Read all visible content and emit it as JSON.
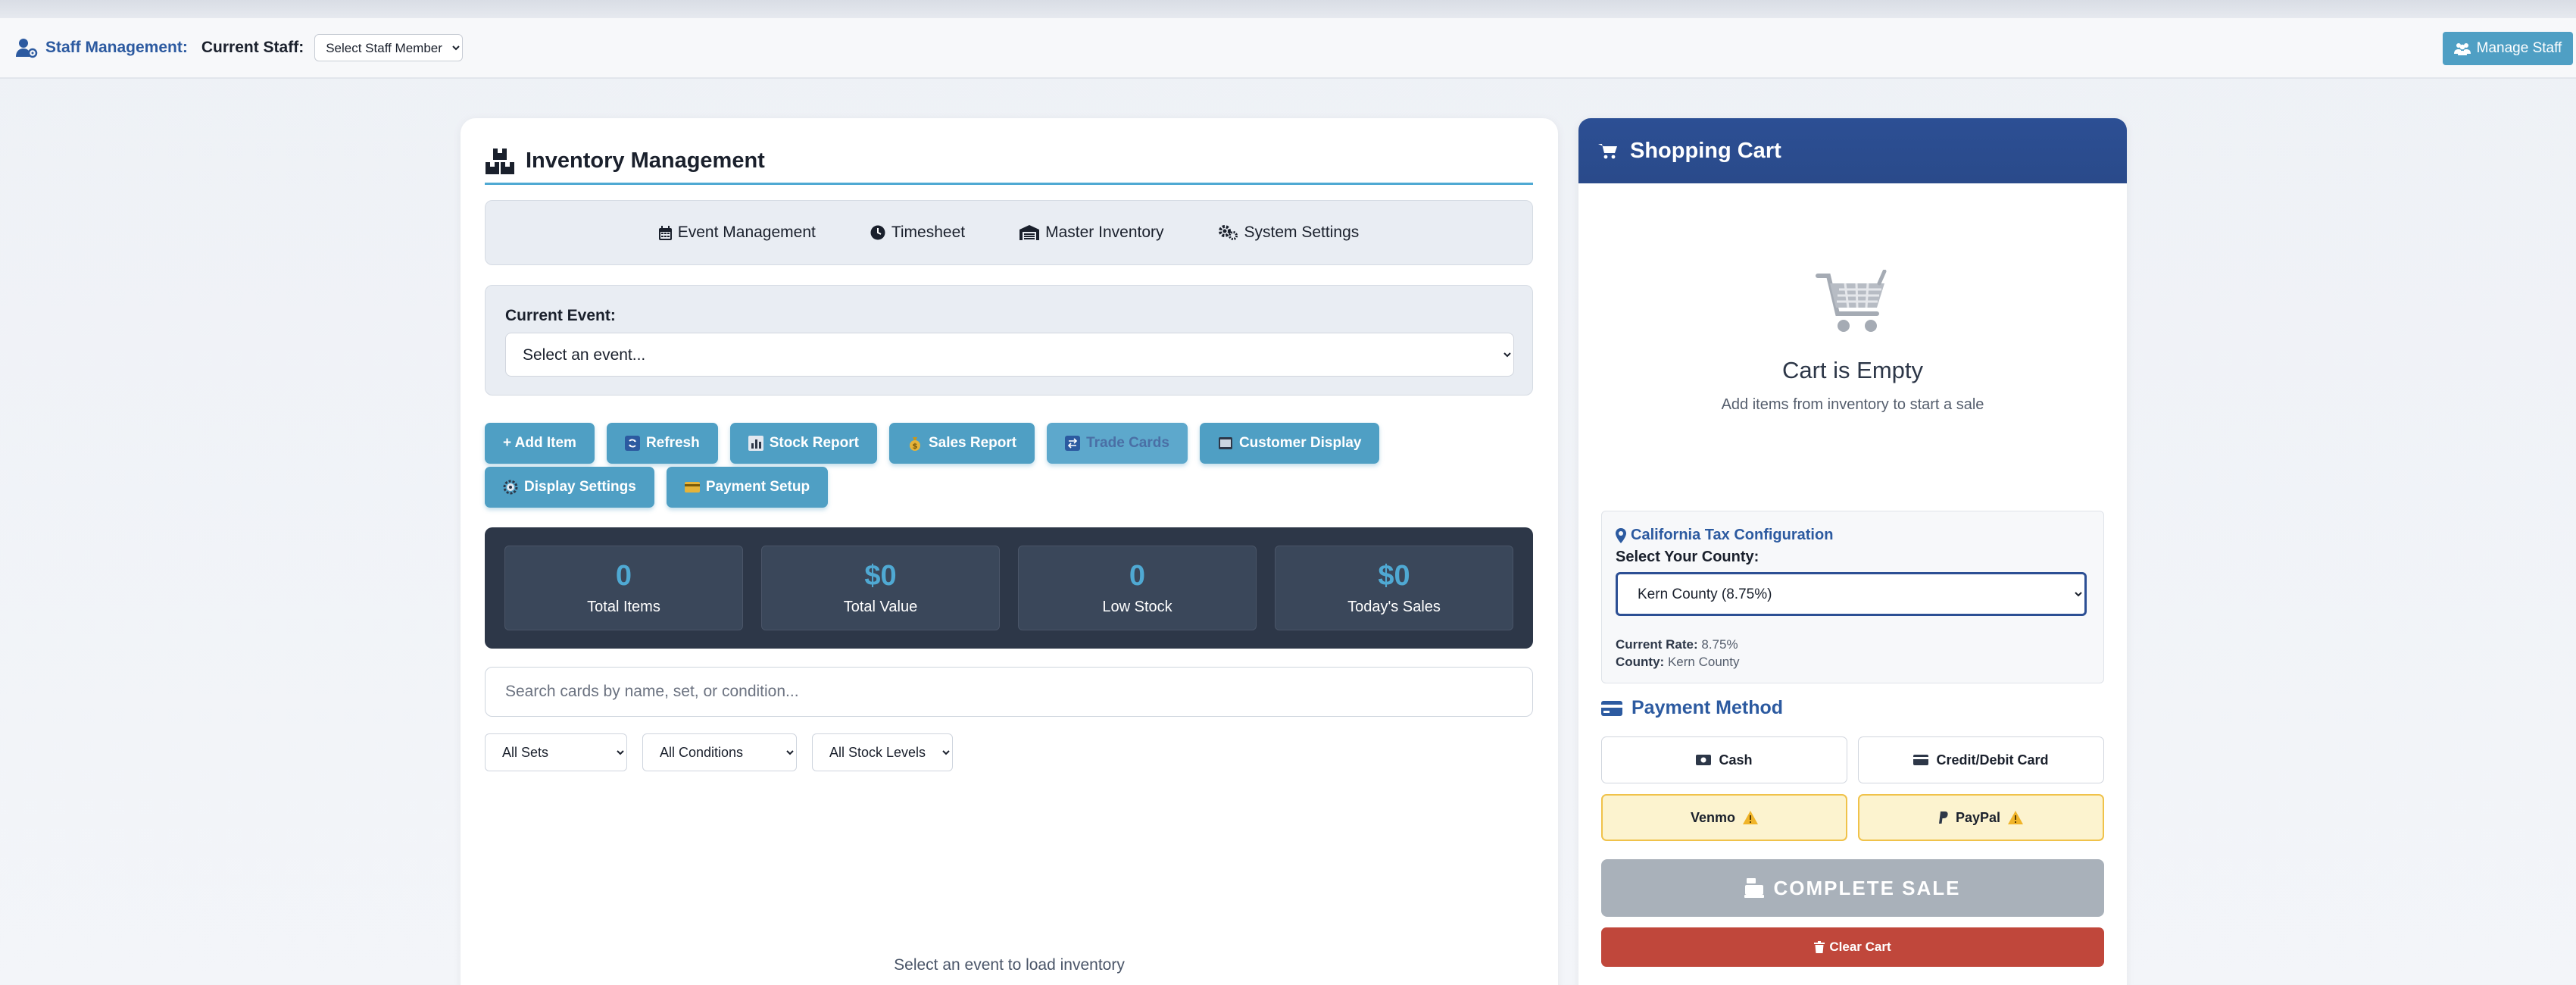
{
  "staff_bar": {
    "title": "Staff Management:",
    "current_label": "Current Staff:",
    "selected": "Select Staff Member",
    "manage_label": "Manage Staff"
  },
  "inventory": {
    "title": "Inventory Management",
    "tabs": [
      {
        "label": "Event Management",
        "icon": "calendar-icon"
      },
      {
        "label": "Timesheet",
        "icon": "clock-icon"
      },
      {
        "label": "Master Inventory",
        "icon": "warehouse-icon"
      },
      {
        "label": "System Settings",
        "icon": "gears-icon"
      }
    ],
    "event_label": "Current Event:",
    "event_selected": "Select an event...",
    "actions": [
      {
        "label": "+ Add Item"
      },
      {
        "label": "Refresh"
      },
      {
        "label": "Stock Report"
      },
      {
        "label": "Sales Report"
      },
      {
        "label": "Trade Cards"
      },
      {
        "label": "Customer Display"
      },
      {
        "label": "Display Settings"
      },
      {
        "label": "Payment Setup"
      }
    ],
    "stats": [
      {
        "value": "0",
        "label": "Total Items"
      },
      {
        "value": "$0",
        "label": "Total Value"
      },
      {
        "value": "0",
        "label": "Low Stock"
      },
      {
        "value": "$0",
        "label": "Today's Sales"
      }
    ],
    "search_placeholder": "Search cards by name, set, or condition...",
    "filters": [
      "All Sets",
      "All Conditions",
      "All Stock Levels"
    ],
    "empty_message": "Select an event to load inventory"
  },
  "cart": {
    "title": "Shopping Cart",
    "empty_title": "Cart is Empty",
    "empty_sub": "Add items from inventory to start a sale",
    "tax": {
      "title": "California Tax Configuration",
      "county_label": "Select Your County:",
      "county_selected": "Kern County (8.75%)",
      "rate_label": "Current Rate:",
      "rate_value": "8.75%",
      "county_info_label": "County:",
      "county_info_value": "Kern County"
    },
    "payment_title": "Payment Method",
    "payments": [
      {
        "label": "Cash"
      },
      {
        "label": "Credit/Debit Card"
      },
      {
        "label": "Venmo"
      },
      {
        "label": "PayPal"
      }
    ],
    "complete_label": "COMPLETE SALE",
    "clear_label": "Clear Cart"
  },
  "colors": {
    "accent": "#4f9fc4",
    "cart_header": "#2c4f94",
    "danger": "#c0473b",
    "warning_bg": "#fcf3cf"
  }
}
